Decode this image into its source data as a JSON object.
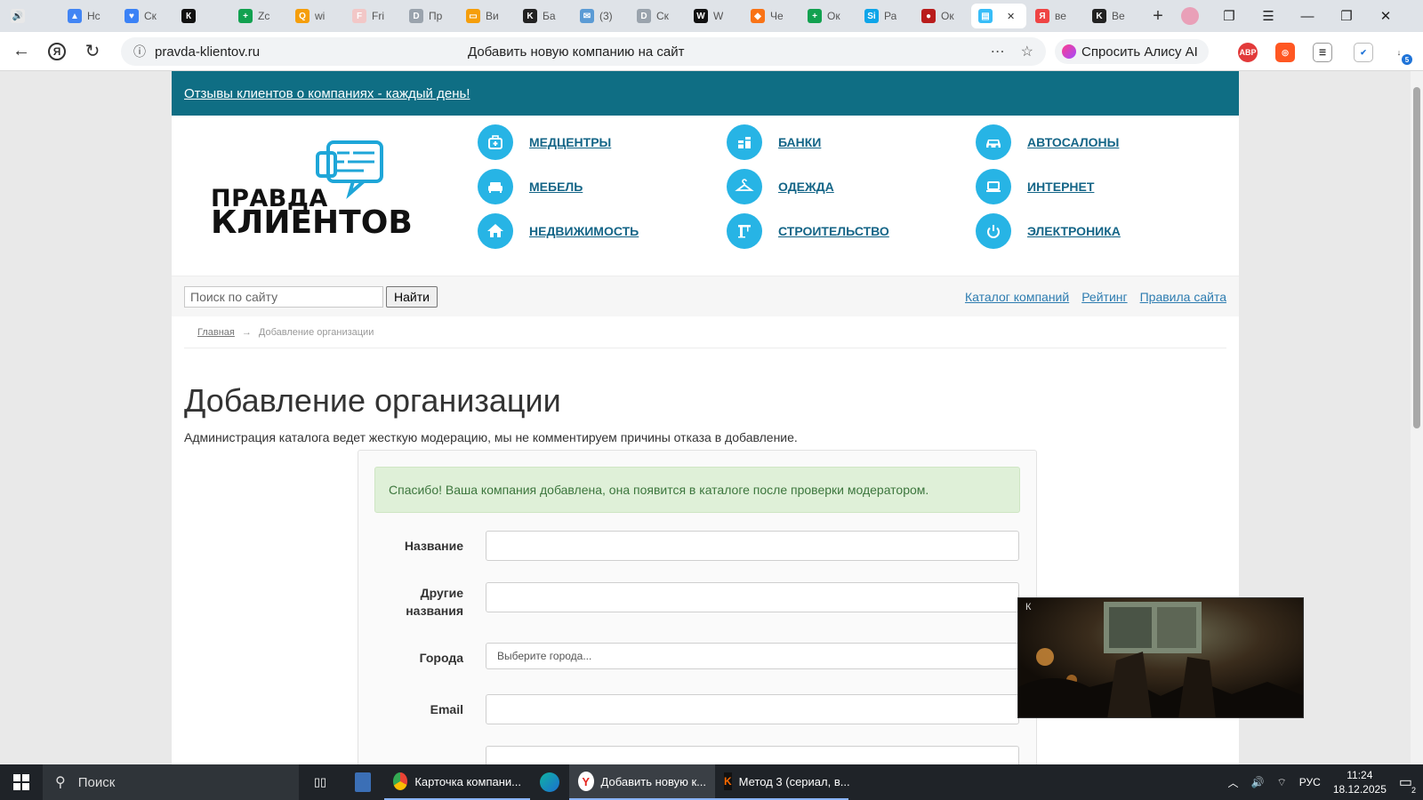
{
  "browser": {
    "tabs": [
      {
        "title": "",
        "color": "#e8e8e8",
        "glyph": "🔊",
        "active": false
      },
      {
        "title": "Нс",
        "color": "#4285f4",
        "glyph": "▲",
        "active": false
      },
      {
        "title": "Ск",
        "color": "#3b82f6",
        "glyph": "♥",
        "active": false
      },
      {
        "title": "",
        "color": "#111111",
        "glyph": "К",
        "active": false
      },
      {
        "title": "Zc",
        "color": "#12a150",
        "glyph": "+",
        "active": false
      },
      {
        "title": "wi",
        "color": "#f59e0b",
        "glyph": "Q",
        "active": false
      },
      {
        "title": "Fri",
        "color": "#f2c7c7",
        "glyph": "F",
        "active": false
      },
      {
        "title": "Пр",
        "color": "#9aa3ad",
        "glyph": "D",
        "active": false
      },
      {
        "title": "Ви",
        "color": "#f59e0b",
        "glyph": "▭",
        "active": false
      },
      {
        "title": "Ба",
        "color": "#222222",
        "glyph": "K",
        "active": false
      },
      {
        "title": "(3)",
        "color": "#5b9bd5",
        "glyph": "✉",
        "active": false
      },
      {
        "title": "Ск",
        "color": "#9aa3ad",
        "glyph": "D",
        "active": false
      },
      {
        "title": "W",
        "color": "#111111",
        "glyph": "W",
        "active": false
      },
      {
        "title": "Че",
        "color": "#f97316",
        "glyph": "◆",
        "active": false
      },
      {
        "title": "Ок",
        "color": "#12a150",
        "glyph": "+",
        "active": false
      },
      {
        "title": "Ра",
        "color": "#0ea5e9",
        "glyph": "Si",
        "active": false
      },
      {
        "title": "Ок",
        "color": "#b91c1c",
        "glyph": "●",
        "active": false
      },
      {
        "title": "",
        "color": "#38bdf8",
        "glyph": "▤",
        "active": true
      },
      {
        "title": "ве",
        "color": "#ef4444",
        "glyph": "Я",
        "active": false
      },
      {
        "title": "Ве",
        "color": "#222222",
        "glyph": "K",
        "active": false
      }
    ],
    "domain": "pravda-klientov.ru",
    "page_title": "Добавить новую компанию на сайт",
    "alice_label": "Спросить Алису AI",
    "downloads_badge": "5"
  },
  "site": {
    "top_link": "Отзывы клиентов о компаниях - каждый день!",
    "logo_line1": "ПРАВДА",
    "logo_line2": "КЛИЕНТОВ",
    "categories": [
      {
        "label": "МЕДЦЕНТРЫ",
        "icon": "medkit-icon"
      },
      {
        "label": "БАНКИ",
        "icon": "coins-icon"
      },
      {
        "label": "АВТОСАЛОНЫ",
        "icon": "car-icon"
      },
      {
        "label": "МЕБЕЛЬ",
        "icon": "sofa-icon"
      },
      {
        "label": "ОДЕЖДА",
        "icon": "hanger-icon"
      },
      {
        "label": "ИНТЕРНЕТ",
        "icon": "laptop-icon"
      },
      {
        "label": "НЕДВИЖИМОСТЬ",
        "icon": "house-icon"
      },
      {
        "label": "СТРОИТЕЛЬСТВО",
        "icon": "crane-icon"
      },
      {
        "label": "ЭЛЕКТРОНИКА",
        "icon": "power-icon"
      }
    ],
    "search_placeholder": "Поиск по сайту",
    "search_button": "Найти",
    "nav_links": [
      "Каталог компаний",
      "Рейтинг",
      "Правила сайта"
    ],
    "breadcrumb_home": "Главная",
    "breadcrumb_current": "Добавление организации",
    "heading": "Добавление организации",
    "note": "Администрация каталога ведет жесткую модерацию, мы не комментируем причины отказа в добавление.",
    "alert": "Спасибо! Ваша компания добавлена, она появится в каталоге после проверки модератором.",
    "fields": {
      "name_label": "Название",
      "other_names_label_1": "Другие",
      "other_names_label_2": "названия",
      "cities_label": "Города",
      "cities_placeholder": "Выберите города...",
      "email_label": "Email"
    }
  },
  "taskbar": {
    "search": "Поиск",
    "items": [
      {
        "label": "Карточка компани..."
      },
      {
        "label": "Добавить новую к..."
      },
      {
        "label": "Метод 3 (сериал, в..."
      }
    ],
    "lang": "РУС",
    "time": "11:24",
    "date": "18.12.2025",
    "notif_count": "2"
  }
}
